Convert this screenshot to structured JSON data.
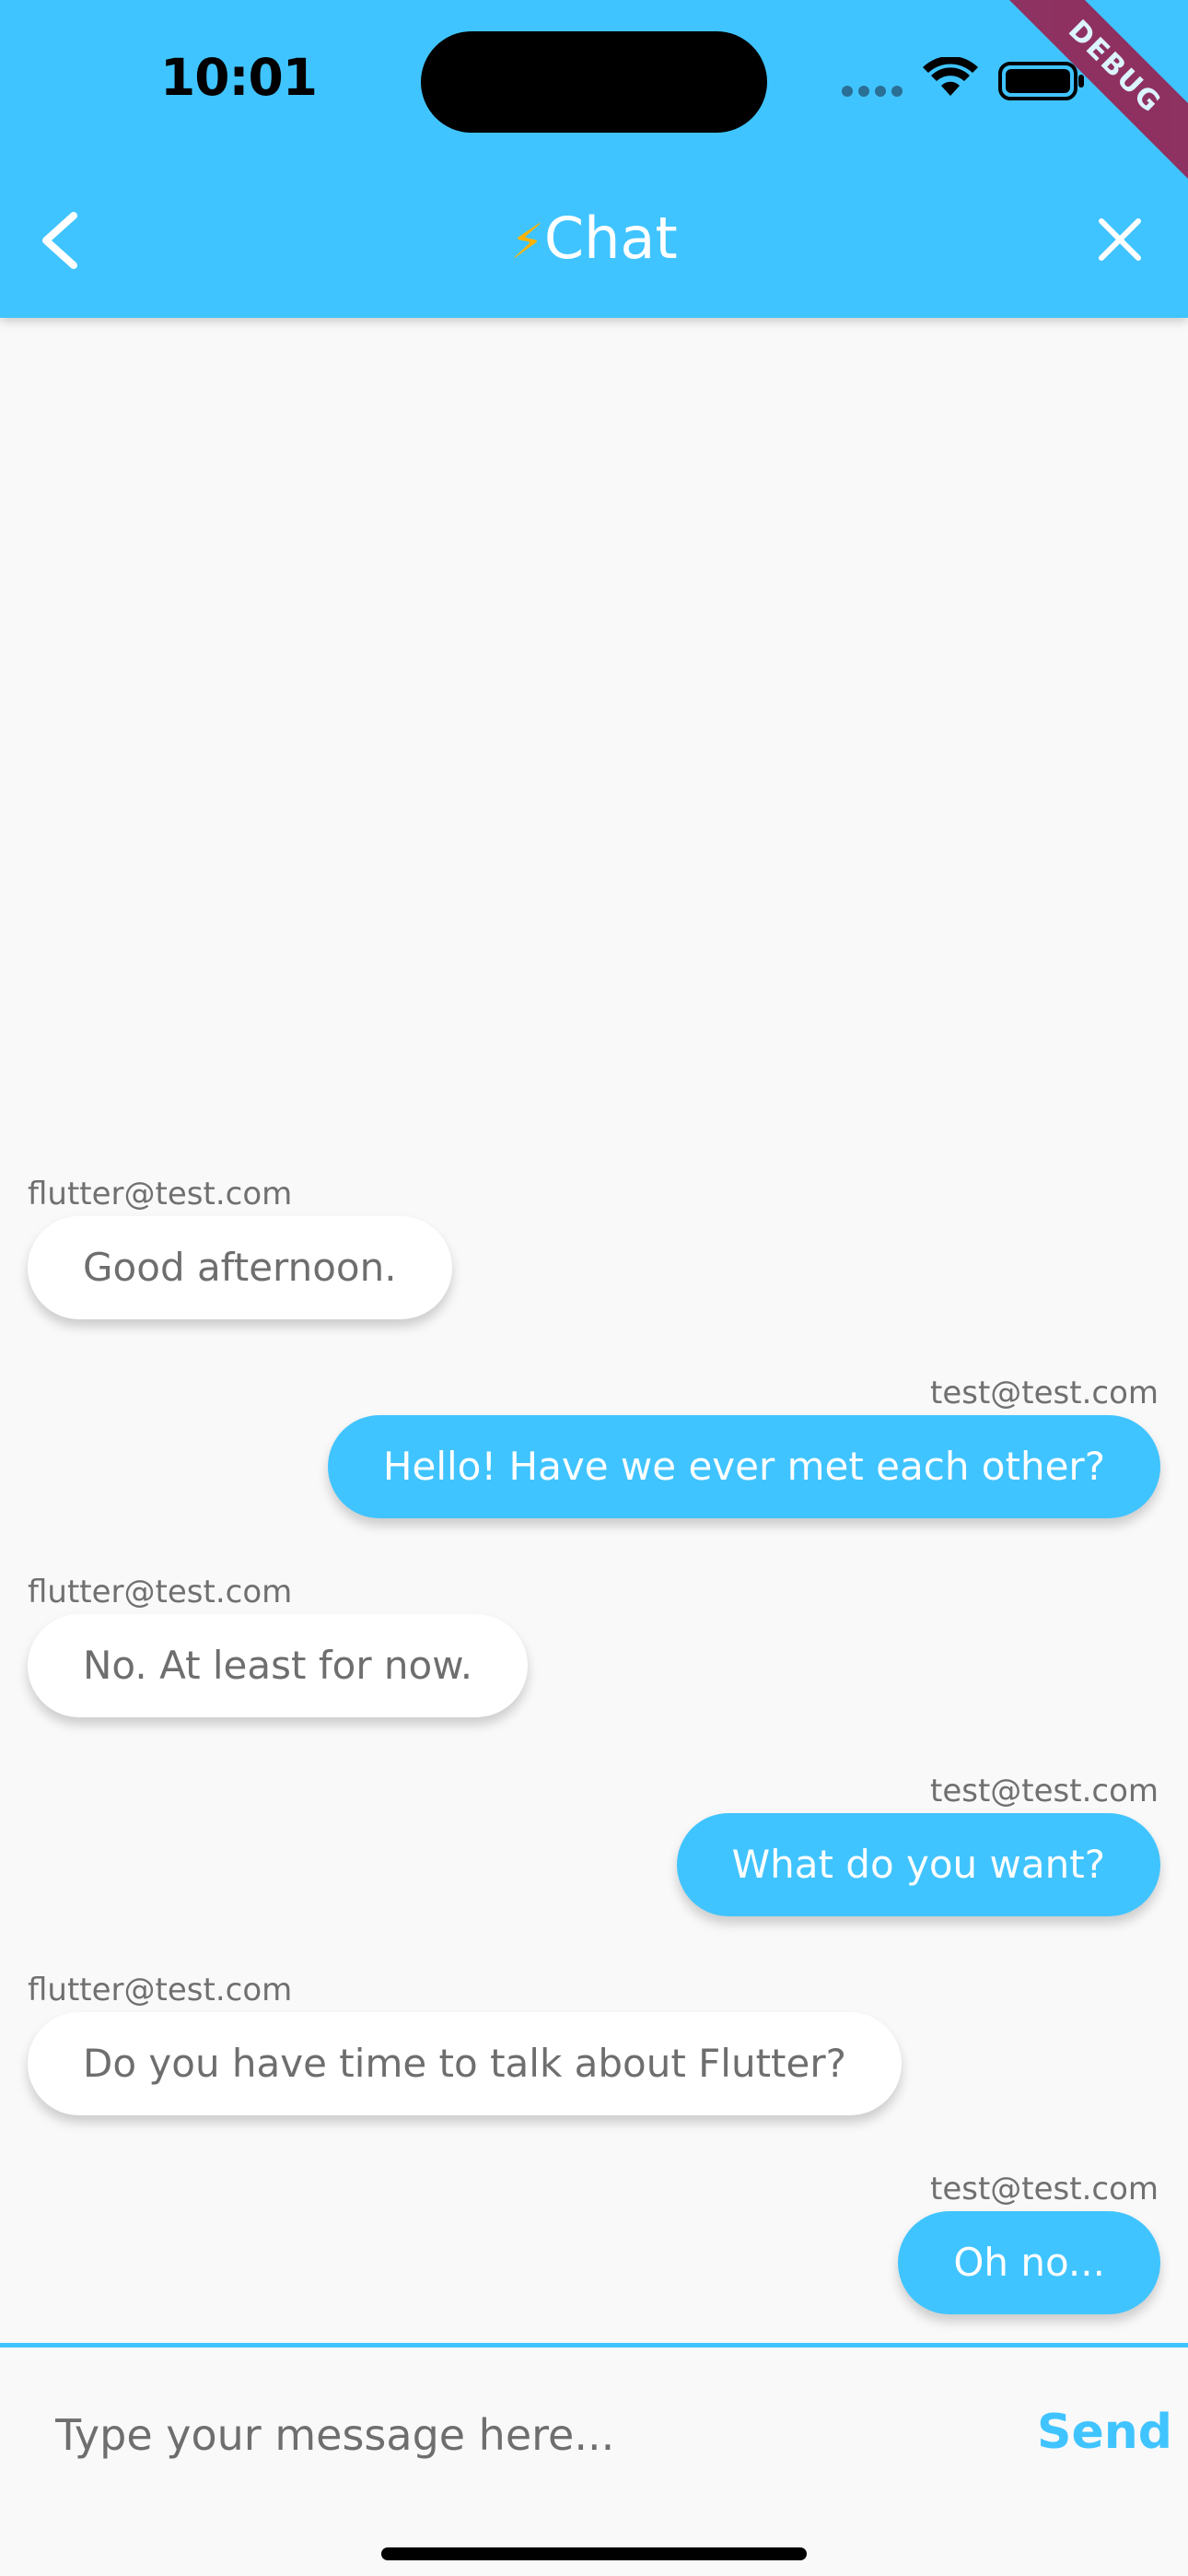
{
  "status_bar": {
    "time": "10:01"
  },
  "debug_banner": "DEBUG",
  "app_bar": {
    "title_icon": "⚡",
    "title": "Chat"
  },
  "messages": [
    {
      "sender": "flutter@test.com",
      "text": "Good afternoon.",
      "direction": "incoming"
    },
    {
      "sender": "test@test.com",
      "text": "Hello! Have we ever met each other?",
      "direction": "outgoing"
    },
    {
      "sender": "flutter@test.com",
      "text": "No. At least for now.",
      "direction": "incoming"
    },
    {
      "sender": "test@test.com",
      "text": "What do you want?",
      "direction": "outgoing"
    },
    {
      "sender": "flutter@test.com",
      "text": "Do you have time to talk about Flutter?",
      "direction": "incoming"
    },
    {
      "sender": "test@test.com",
      "text": "Oh no...",
      "direction": "outgoing"
    }
  ],
  "composer": {
    "placeholder": "Type your message here...",
    "value": "",
    "send_label": "Send"
  },
  "colors": {
    "accent": "#40c4ff",
    "background": "#f9f9f9"
  },
  "icons": [
    "back-chevron-icon",
    "close-icon",
    "wifi-icon",
    "battery-icon"
  ]
}
